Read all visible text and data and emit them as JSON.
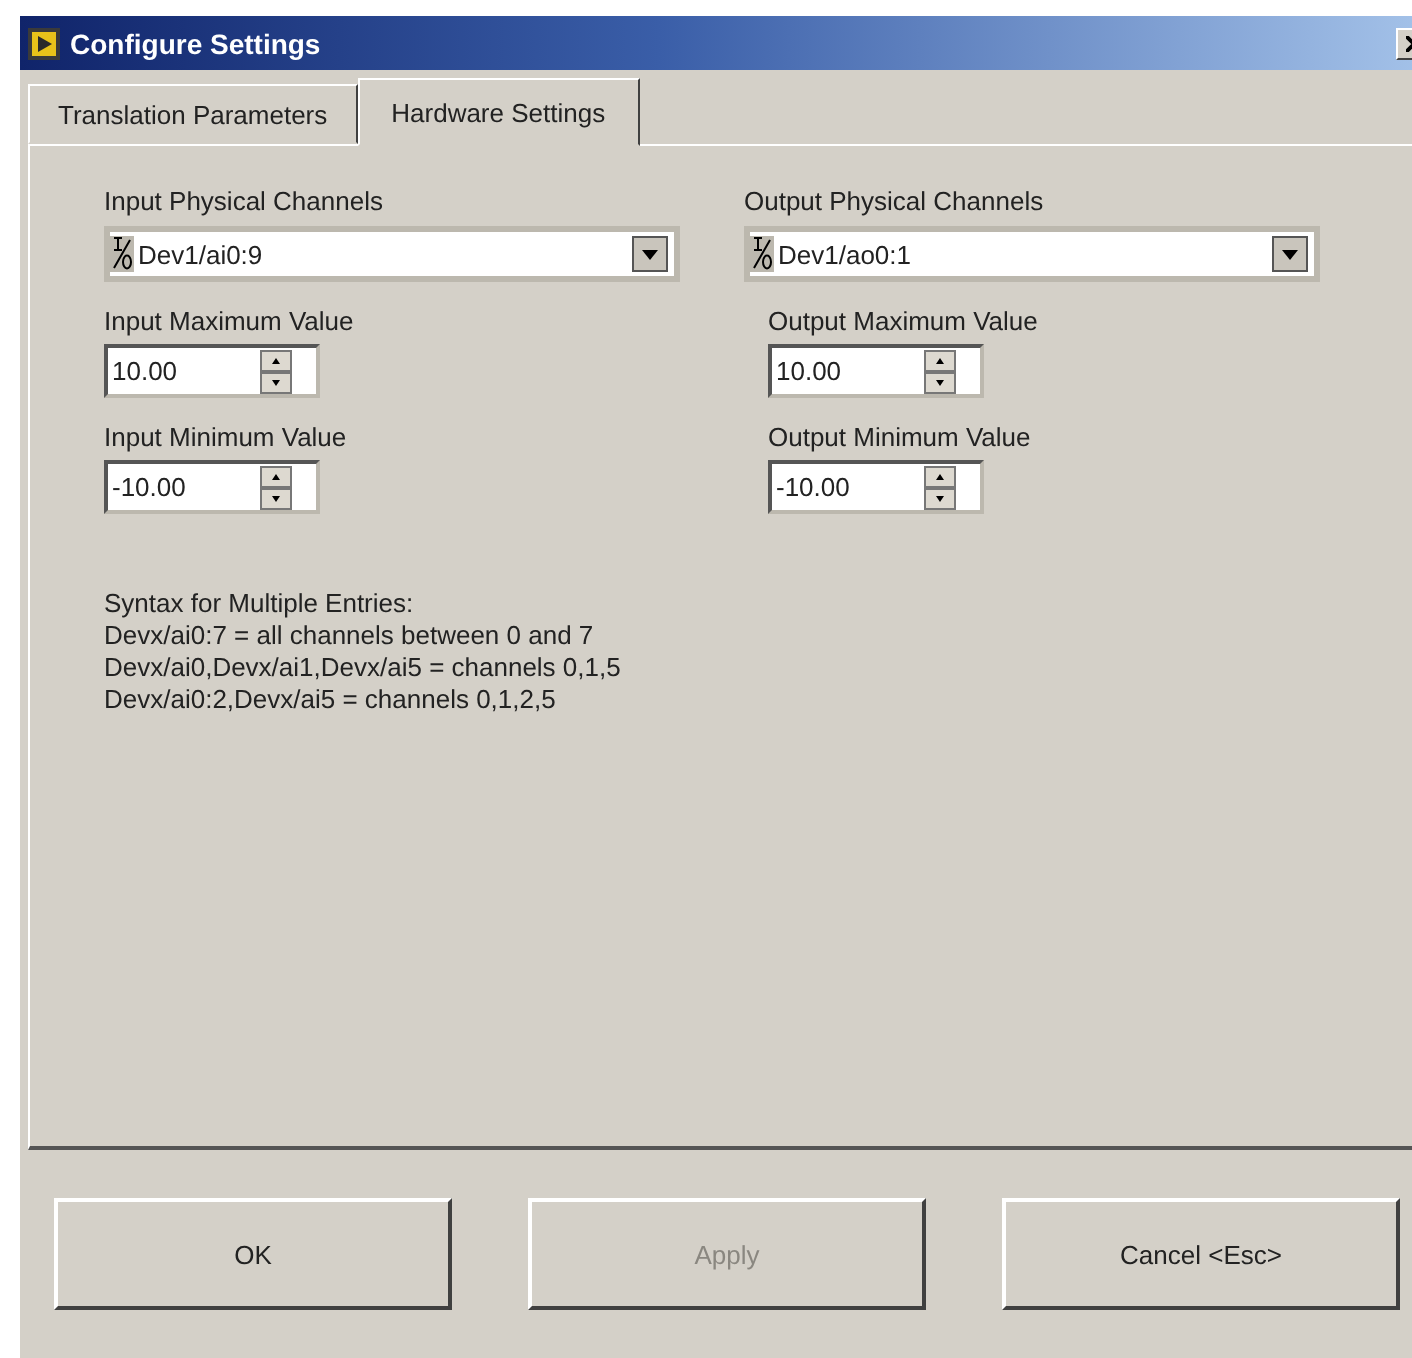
{
  "window": {
    "title": "Configure Settings"
  },
  "tabs": [
    {
      "label": "Translation Parameters",
      "selected": false
    },
    {
      "label": "Hardware Settings",
      "selected": true
    }
  ],
  "columns": [
    {
      "channel": {
        "label": "Input Physical Channels",
        "value": "Dev1/ai0:9"
      },
      "maximum": {
        "label": "Input Maximum Value",
        "value": "10.00"
      },
      "minimum": {
        "label": "Input Minimum Value",
        "value": "-10.00"
      }
    },
    {
      "channel": {
        "label": "Output Physical Channels",
        "value": "Dev1/ao0:1"
      },
      "maximum": {
        "label": "Output Maximum Value",
        "value": "10.00"
      },
      "minimum": {
        "label": "Output Minimum Value",
        "value": "-10.00"
      }
    }
  ],
  "syntax_help": [
    "Syntax for Multiple Entries:",
    "Devx/ai0:7 = all channels between 0 and 7",
    "Devx/ai0,Devx/ai1,Devx/ai5 = channels 0,1,5",
    "Devx/ai0:2,Devx/ai5 = channels 0,1,2,5"
  ],
  "buttons": [
    {
      "label": "OK",
      "disabled": false
    },
    {
      "label": "Apply",
      "disabled": true
    },
    {
      "label": "Cancel <Esc>",
      "disabled": false
    }
  ]
}
